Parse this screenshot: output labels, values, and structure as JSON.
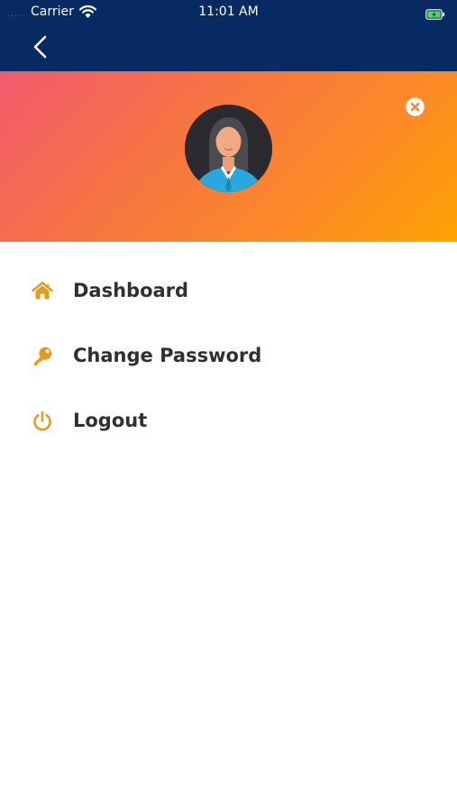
{
  "status_bar": {
    "carrier": "Carrier",
    "time": "11:01 AM",
    "signal_dots": "....",
    "wifi_icon": "wifi-icon",
    "battery_icon": "battery-charging-icon"
  },
  "nav_bar": {
    "back_icon": "chevron-left-icon",
    "background_color": "#072a63"
  },
  "header": {
    "avatar_icon": "user-avatar-icon",
    "close_icon": "close-circle-icon",
    "gradient_colors": [
      "#f25a6e",
      "#ffa200"
    ]
  },
  "menu": {
    "accent_color": "#e39a22",
    "items": [
      {
        "label": "Dashboard",
        "icon": "home-icon"
      },
      {
        "label": "Change Password",
        "icon": "key-icon"
      },
      {
        "label": "Logout",
        "icon": "power-icon"
      }
    ]
  }
}
